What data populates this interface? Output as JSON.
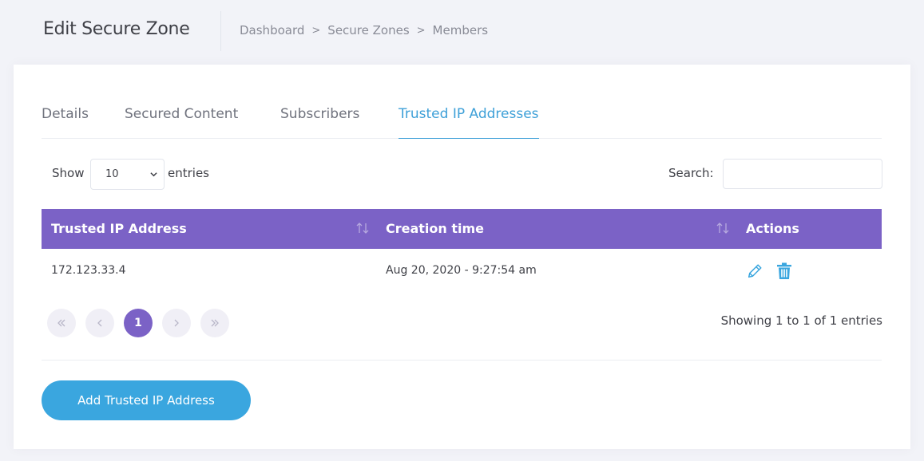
{
  "header": {
    "title": "Edit Secure Zone",
    "breadcrumb": [
      "Dashboard",
      "Secure Zones",
      "Members"
    ],
    "breadcrumb_separator": ">"
  },
  "tabs": [
    {
      "label": "Details",
      "active": false
    },
    {
      "label": "Secured Content",
      "active": false
    },
    {
      "label": "Subscribers",
      "active": false
    },
    {
      "label": "Trusted IP Addresses",
      "active": true
    }
  ],
  "table_controls": {
    "show_label": "Show",
    "length_value": "10",
    "entries_label": "entries",
    "search_label": "Search:",
    "search_value": ""
  },
  "table": {
    "columns": [
      "Trusted IP Address",
      "Creation time",
      "Actions"
    ],
    "rows": [
      {
        "ip": "172.123.33.4",
        "created": "Aug 20, 2020 - 9:27:54 am",
        "actions": [
          "edit-icon",
          "trash-icon"
        ]
      }
    ]
  },
  "pagination": {
    "current_page": "1",
    "info": "Showing 1 to 1 of 1 entries"
  },
  "add_button_label": "Add Trusted IP Address",
  "colors": {
    "header_purple": "#7b62c6",
    "accent_blue": "#3aa6df",
    "active_tab": "#3ea0d8",
    "page_bg": "#f2f3f8"
  }
}
